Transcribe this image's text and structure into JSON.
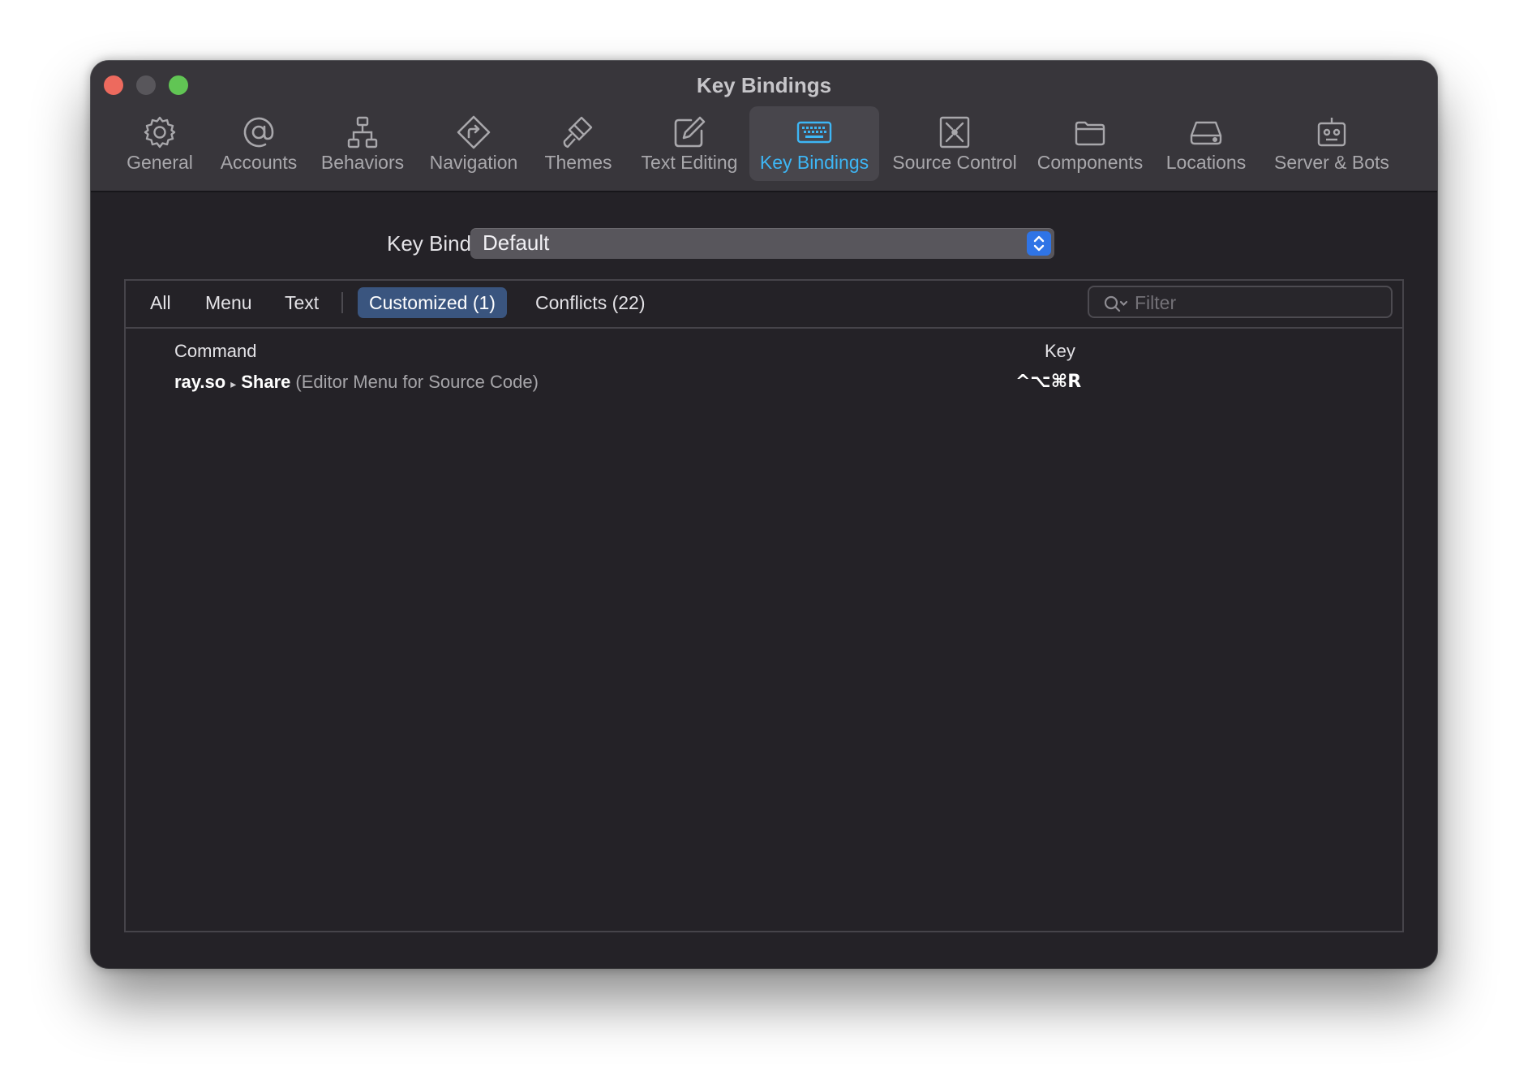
{
  "window": {
    "title": "Key Bindings"
  },
  "toolbar": {
    "tabs": [
      {
        "label": "General",
        "icon": "gear-icon"
      },
      {
        "label": "Accounts",
        "icon": "at-sign-icon"
      },
      {
        "label": "Behaviors",
        "icon": "hierarchy-icon"
      },
      {
        "label": "Navigation",
        "icon": "route-diamond-icon"
      },
      {
        "label": "Themes",
        "icon": "paintbrush-icon"
      },
      {
        "label": "Text Editing",
        "icon": "pencil-square-icon"
      },
      {
        "label": "Key Bindings",
        "icon": "keyboard-icon",
        "active": true
      },
      {
        "label": "Source Control",
        "icon": "source-control-icon"
      },
      {
        "label": "Components",
        "icon": "folder-icon"
      },
      {
        "label": "Locations",
        "icon": "drive-icon"
      },
      {
        "label": "Server & Bots",
        "icon": "robot-icon"
      }
    ]
  },
  "key_bindings_set": {
    "label": "Key Bindings Set",
    "value": "Default"
  },
  "scope_bar": {
    "all": "All",
    "menu": "Menu",
    "text": "Text",
    "customized": "Customized (1)",
    "conflicts": "Conflicts (22)",
    "selected": "Customized (1)"
  },
  "filter": {
    "placeholder": "Filter",
    "value": ""
  },
  "table": {
    "columns": {
      "command": "Command",
      "key": "Key"
    },
    "rows": [
      {
        "command_prefix": "ray.so",
        "separator": "▸",
        "command_name": "Share",
        "context": "(Editor Menu for Source Code)",
        "key": "^⌥⌘R"
      }
    ]
  },
  "colors": {
    "accent": "#3db6f5",
    "selected_scope": "#3a557f",
    "stepper": "#2f74e6",
    "close": "#ed6a5e",
    "minimize": "#58565b",
    "zoom": "#61c554"
  }
}
